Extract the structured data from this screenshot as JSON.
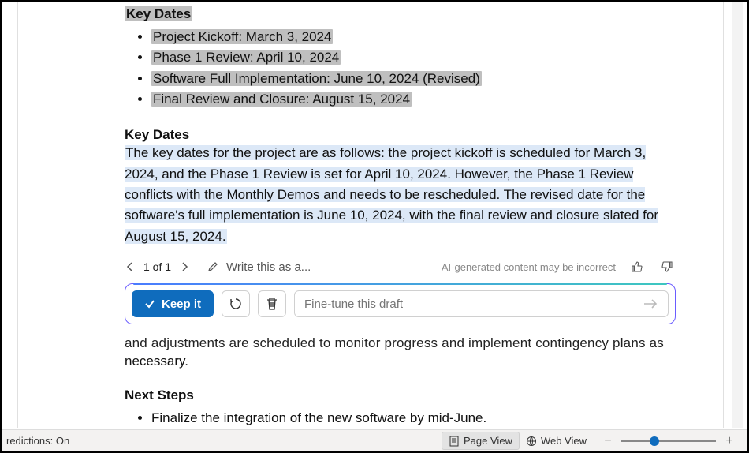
{
  "section1": {
    "heading": "Key Dates",
    "items": [
      "Project Kickoff: March 3, 2024",
      "Phase 1 Review: April 10, 2024",
      "Software Full Implementation: June 10, 2024 (Revised)",
      "Final Review and Closure: August 15, 2024"
    ]
  },
  "section2": {
    "heading": "Key Dates",
    "paragraph": "The key dates for the project are as follows: the project kickoff is scheduled for March 3, 2024, and the Phase 1 Review is set for April 10, 2024. However, the Phase 1 Review conflicts with the Monthly Demos and needs to be rescheduled. The revised date for the software's full implementation is June 10, 2024, with the final review and closure slated for August 15, 2024."
  },
  "ai": {
    "pager": "1 of 1",
    "write_label": "Write this as a...",
    "disclaimer": "AI-generated content may be incorrect",
    "keep_label": "Keep it",
    "finetune_placeholder": "Fine-tune this draft"
  },
  "below": {
    "truncated": "and adjustments are scheduled to monitor progress and implement contingency plans as",
    "rest": "necessary.",
    "next_heading": "Next Steps",
    "next_item": "Finalize the integration of the new software by mid-June."
  },
  "status": {
    "predictions": "redictions: On",
    "page_view": "Page View",
    "web_view": "Web View"
  }
}
